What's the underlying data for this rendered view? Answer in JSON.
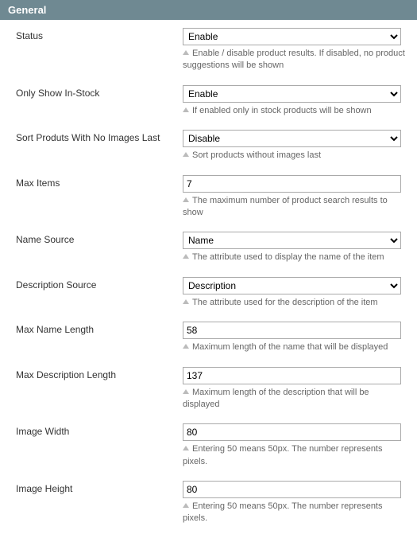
{
  "panel": {
    "title": "General"
  },
  "fields": {
    "status": {
      "label": "Status",
      "value": "Enable",
      "hint": "Enable / disable product results. If disabled, no product suggestions will be shown"
    },
    "only_in_stock": {
      "label": "Only Show In-Stock",
      "value": "Enable",
      "hint": "If enabled only in stock products will be shown"
    },
    "sort_no_images": {
      "label": "Sort Produts With No Images Last",
      "value": "Disable",
      "hint": "Sort products without images last"
    },
    "max_items": {
      "label": "Max Items",
      "value": "7",
      "hint": "The maximum number of product search results to show"
    },
    "name_source": {
      "label": "Name Source",
      "value": "Name",
      "hint": "The attribute used to display the name of the item"
    },
    "description_source": {
      "label": "Description Source",
      "value": "Description",
      "hint": "The attribute used for the description of the item"
    },
    "max_name_length": {
      "label": "Max Name Length",
      "value": "58",
      "hint": "Maximum length of the name that will be displayed"
    },
    "max_description_length": {
      "label": "Max Description Length",
      "value": "137",
      "hint": "Maximum length of the description that will be displayed"
    },
    "image_width": {
      "label": "Image Width",
      "value": "80",
      "hint": "Entering 50 means 50px. The number represents pixels."
    },
    "image_height": {
      "label": "Image Height",
      "value": "80",
      "hint": "Entering 50 means 50px. The number represents pixels."
    }
  }
}
